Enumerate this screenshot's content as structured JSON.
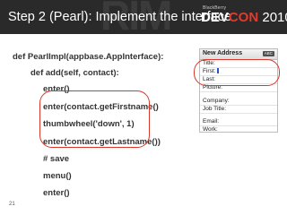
{
  "slide": {
    "title": "Step 2 (Pearl): Implement the interface",
    "page_number": "21"
  },
  "brand": {
    "company": "BlackBerry",
    "event_prefix": "DEV",
    "event_accent": "CON",
    "event_year": "2010",
    "background_mark": "RIM"
  },
  "code": {
    "lines": [
      "def PearlImpl(appbase.AppInterface):",
      "def add(self, contact):",
      "enter()",
      "enter(contact.getFirstname()",
      "thumbwheel('down', 1)",
      "enter(contact.getLastname())",
      "# save",
      "menu()",
      "enter()"
    ]
  },
  "device": {
    "header": "New Address",
    "badge": "ABC",
    "fields": [
      "Title:",
      "First:",
      "Last:",
      "Picture:",
      "Company:",
      "Job Title:",
      "Email:",
      "Work:"
    ]
  },
  "colors": {
    "banner_bg": "#2a2a2a",
    "highlight_red": "#d9372a",
    "cursor_blue": "#1f56c9"
  }
}
